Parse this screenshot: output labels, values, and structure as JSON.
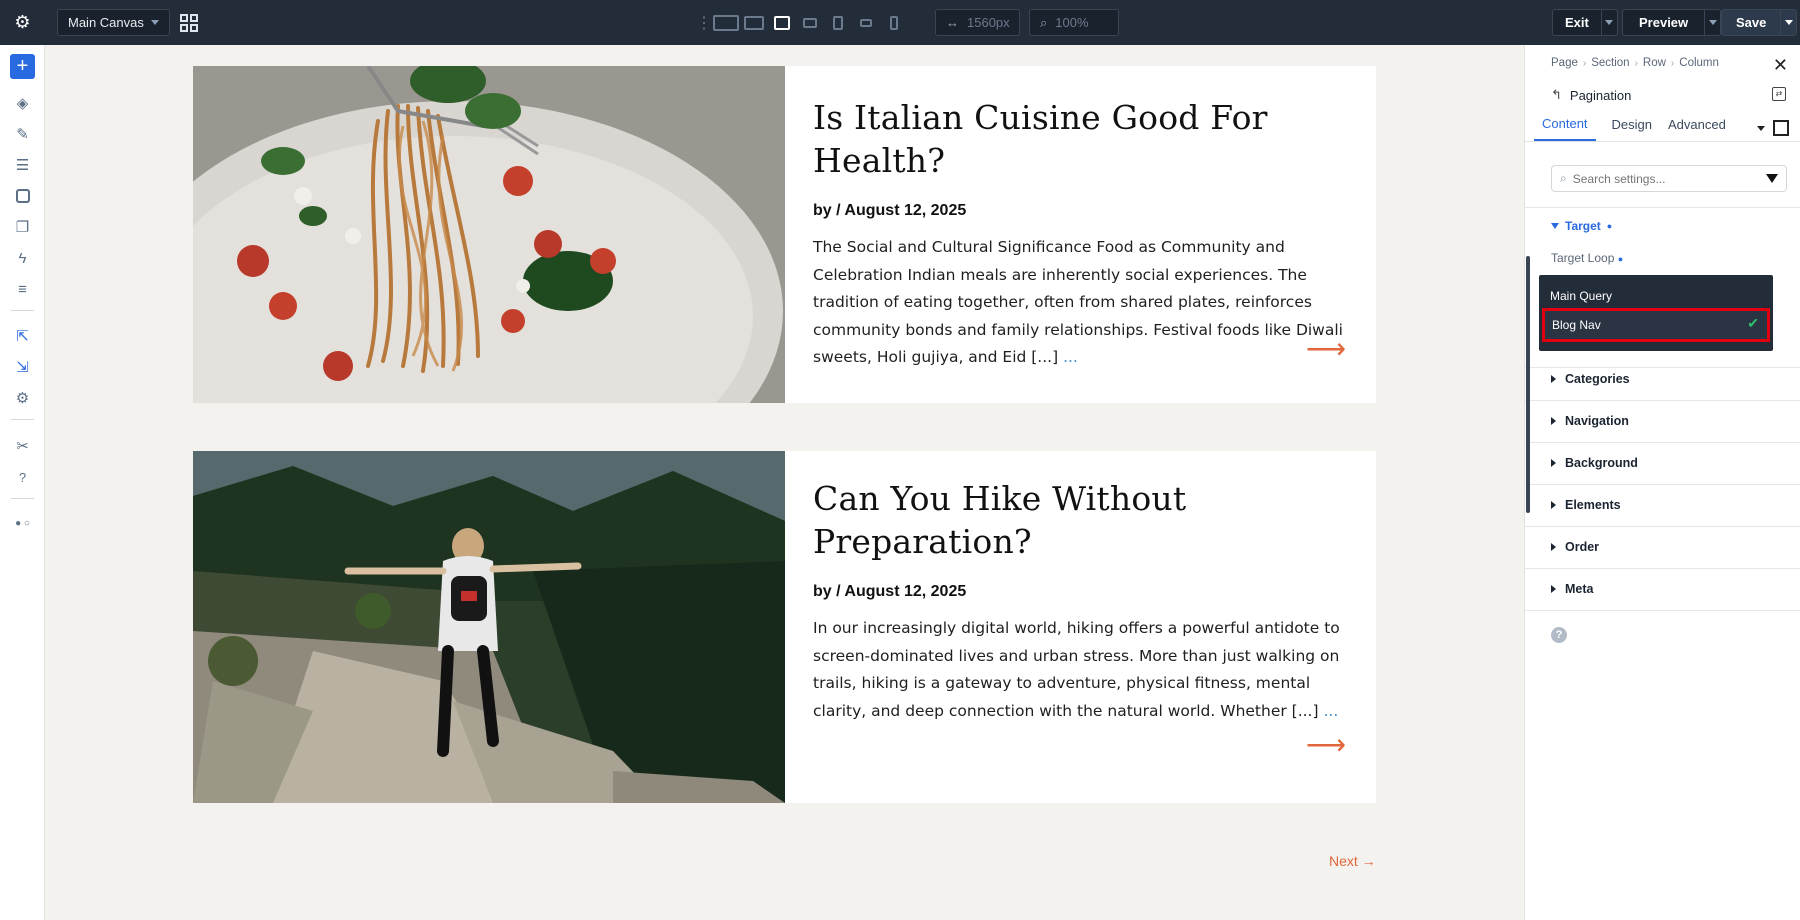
{
  "topbar": {
    "canvas_select": "Main Canvas",
    "width_value": "1560px",
    "zoom_value": "100%",
    "exit_label": "Exit",
    "preview_label": "Preview",
    "save_label": "Save"
  },
  "posts": [
    {
      "title": "Is Italian Cuisine Good For Health?",
      "meta": "by / August 12, 2025",
      "excerpt": "The Social and Cultural Significance Food as Community and Celebration Indian meals are inherently social experiences. The tradition of eating together, often from shared plates, reinforces community bonds and family relationships. Festival foods like Diwali sweets, Holi gujiya, and Eid [...]",
      "more": "..."
    },
    {
      "title": "Can You Hike Without Preparation?",
      "meta": "by / August 12, 2025",
      "excerpt": "In our increasingly digital world, hiking offers a powerful antidote to screen-dominated lives and urban stress. More than just walking on trails, hiking is a gateway to adventure, physical fitness, mental clarity, and deep connection with the natural world. Whether [...]",
      "more": "..."
    }
  ],
  "pagination": {
    "next_label": "Next →"
  },
  "panel": {
    "breadcrumbs": [
      "Page",
      "Section",
      "Row",
      "Column"
    ],
    "element_title": "Pagination",
    "tabs": [
      "Content",
      "Design",
      "Advanced"
    ],
    "search_placeholder": "Search settings...",
    "open_group": "Target",
    "target_loop_label": "Target Loop",
    "dropdown_options": [
      "Main Query",
      "Blog Nav"
    ],
    "selected_option": "Blog Nav",
    "groups": [
      "Categories",
      "Navigation",
      "Background",
      "Elements",
      "Order",
      "Meta"
    ]
  },
  "colors": {
    "topbar_bg": "#232c39",
    "accent_blue": "#2a6ae0",
    "accent_orange": "#e0663b",
    "highlight_red": "#e0000f",
    "check_green": "#2fbf71"
  }
}
